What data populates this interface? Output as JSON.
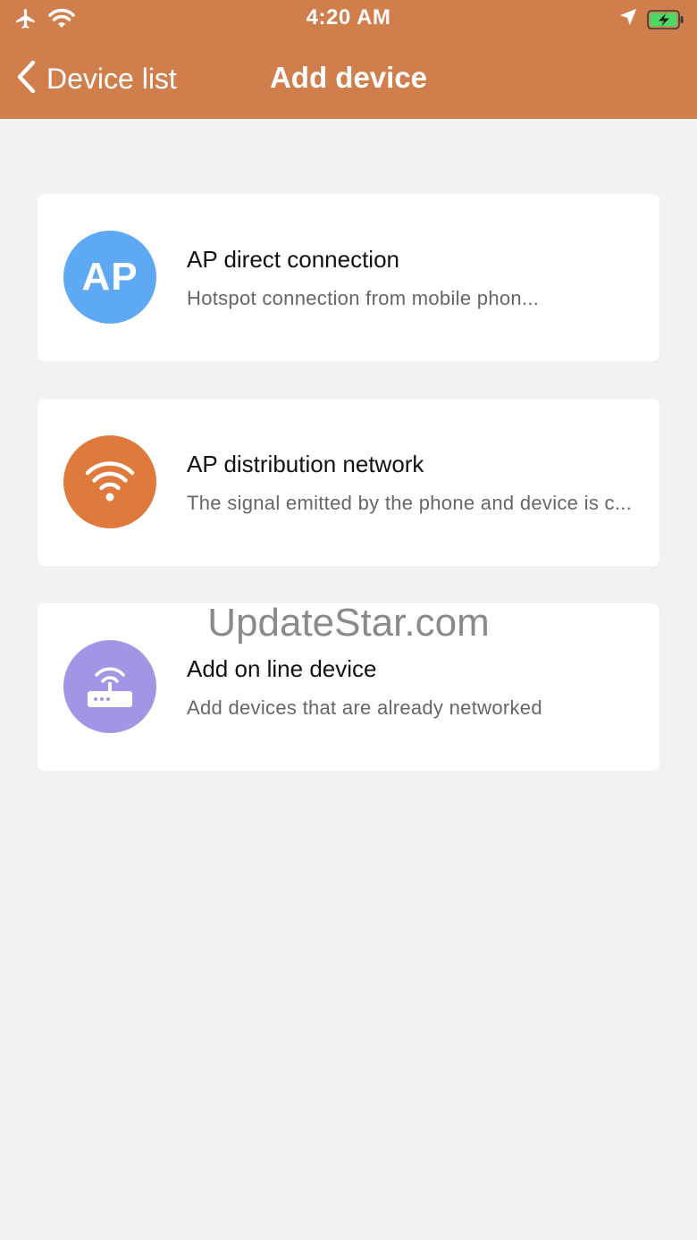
{
  "status_bar": {
    "time": "4:20 AM",
    "icons": [
      "airplane-icon",
      "wifi-icon",
      "location-arrow-icon",
      "battery-charging-icon"
    ]
  },
  "nav": {
    "back_label": "Device list",
    "title": "Add device"
  },
  "cards": [
    {
      "title": "AP direct connection",
      "subtitle": "Hotspot connection from mobile phon...",
      "icon_text": "AP",
      "icon": "ap-icon",
      "color": "#5ea9f4"
    },
    {
      "title": "AP distribution network",
      "subtitle": "The signal emitted by the phone and device is c...",
      "icon": "wifi-icon",
      "color": "#e07a3c"
    },
    {
      "title": "Add on line device",
      "subtitle": "Add devices that are already networked",
      "icon": "router-icon",
      "color": "#a394e6"
    }
  ],
  "watermark": "UpdateStar.com",
  "colors": {
    "header": "#d07e4c",
    "background": "#f2f2f2",
    "card": "#ffffff"
  }
}
